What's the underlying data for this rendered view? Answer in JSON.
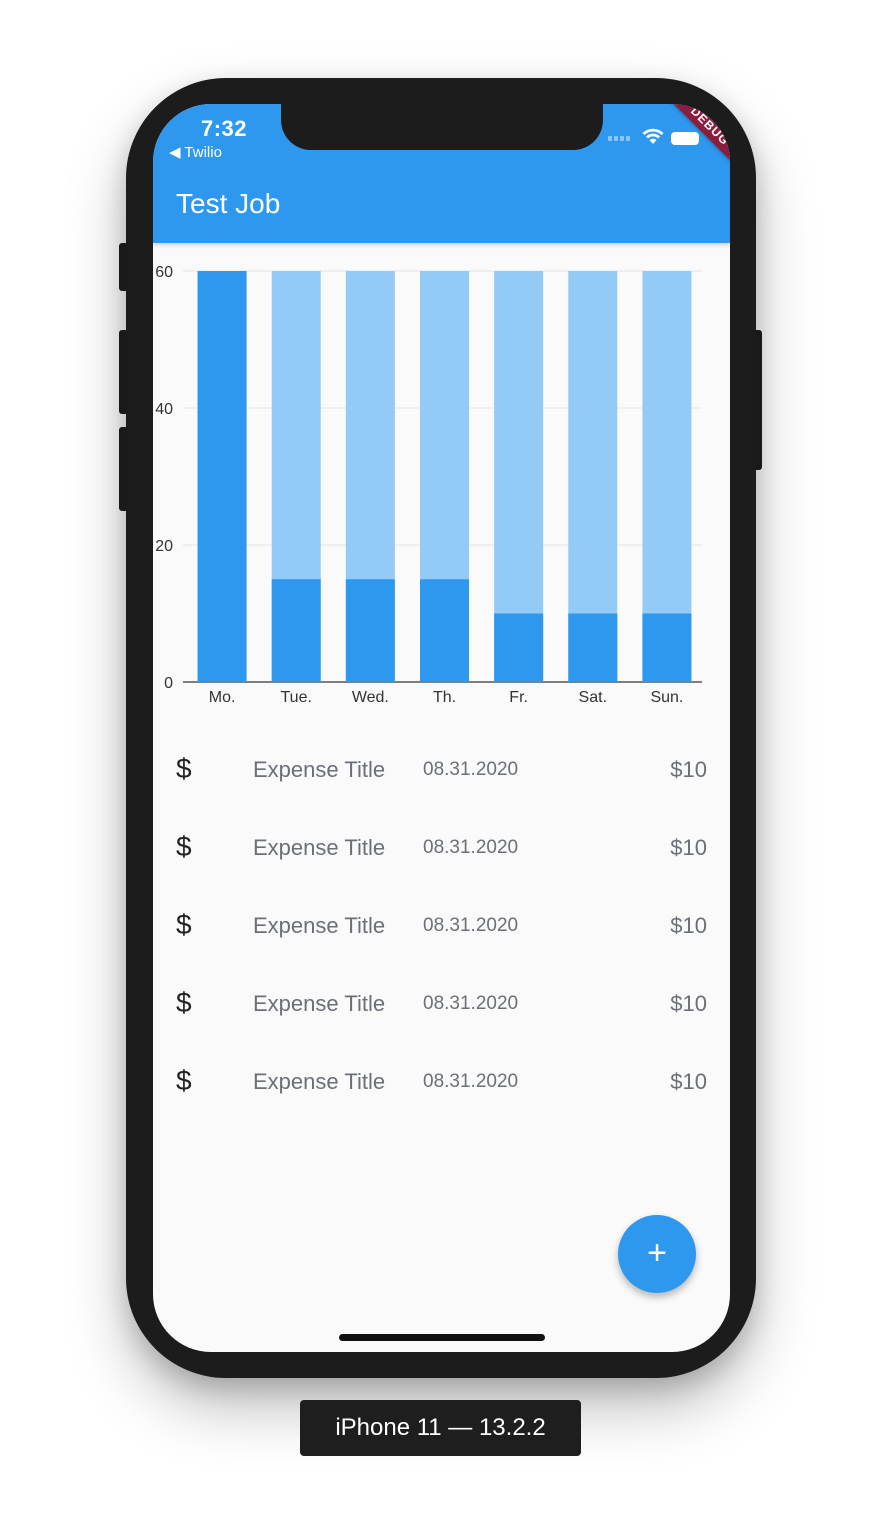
{
  "status_bar": {
    "time": "7:32",
    "back_app": "◀ Twilio",
    "debug_label": "DEBUG"
  },
  "app_bar": {
    "title": "Test Job"
  },
  "colors": {
    "primary": "#2d98ee",
    "bar_background": "#93cbf6",
    "debug_ribbon": "#8b1e3f"
  },
  "chart_data": {
    "type": "bar",
    "categories": [
      "Mo.",
      "Tue.",
      "Wed.",
      "Th.",
      "Fr.",
      "Sat.",
      "Sun."
    ],
    "series": [
      {
        "values": [
          60,
          15,
          15,
          15,
          10,
          10,
          10
        ]
      },
      {
        "values": [
          60,
          60,
          60,
          60,
          60,
          60,
          60
        ]
      }
    ],
    "yticks": [
      "0",
      "20",
      "40",
      "60"
    ],
    "ylim": [
      0,
      60
    ],
    "grid": true
  },
  "expenses": [
    {
      "icon": "$",
      "title": "Expense Title",
      "date": "08.31.2020",
      "amount": "$10"
    },
    {
      "icon": "$",
      "title": "Expense Title",
      "date": "08.31.2020",
      "amount": "$10"
    },
    {
      "icon": "$",
      "title": "Expense Title",
      "date": "08.31.2020",
      "amount": "$10"
    },
    {
      "icon": "$",
      "title": "Expense Title",
      "date": "08.31.2020",
      "amount": "$10"
    },
    {
      "icon": "$",
      "title": "Expense Title",
      "date": "08.31.2020",
      "amount": "$10"
    }
  ],
  "fab": {
    "label": "+",
    "icon": "add-icon"
  },
  "device_label": "iPhone 11 — 13.2.2"
}
